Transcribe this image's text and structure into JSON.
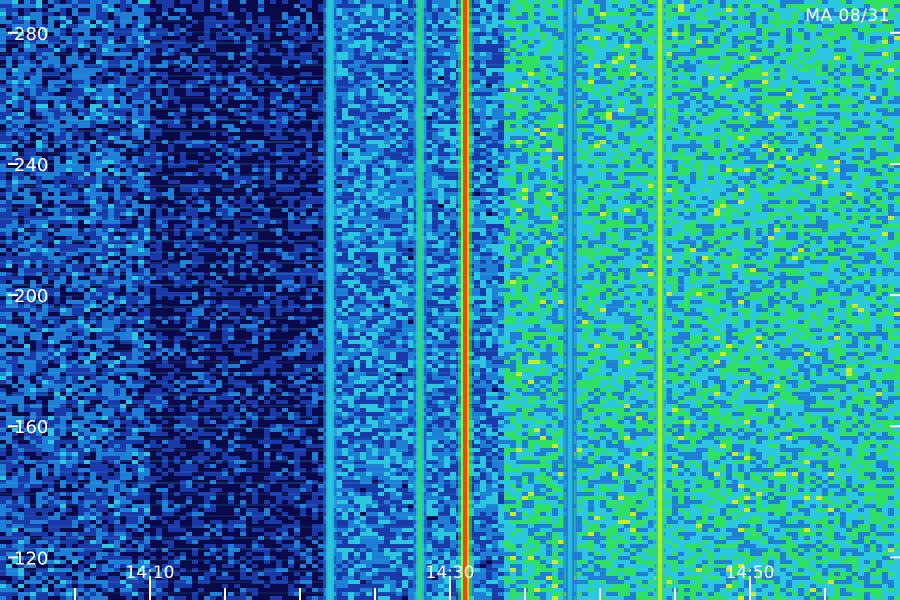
{
  "station_label": "MA 08/31",
  "colors": {
    "background": "#000000",
    "palette": [
      "#000000",
      "#0a0a4a",
      "#1a3aaa",
      "#1f7fd6",
      "#2cc8e0",
      "#30e060",
      "#c8f020",
      "#ff9000",
      "#ff2000"
    ],
    "axis": "#ffffff"
  },
  "chart_data": {
    "type": "heatmap",
    "title": "",
    "xlabel": "",
    "ylabel": "",
    "x_ticks": [
      "14:10",
      "14:30",
      "14:50"
    ],
    "y_ticks": [
      120,
      160,
      200,
      240,
      280
    ],
    "ylim": [
      107,
      290
    ],
    "grid": false,
    "legend": "none",
    "bright_bands": [
      {
        "time": "14:31",
        "intensity": 0.95
      },
      {
        "time": "14:28",
        "intensity": 0.6
      },
      {
        "time": "14:22",
        "intensity": 0.55
      },
      {
        "time": "14:44",
        "intensity": 0.75
      },
      {
        "time": "14:38",
        "intensity": 0.5
      }
    ]
  }
}
